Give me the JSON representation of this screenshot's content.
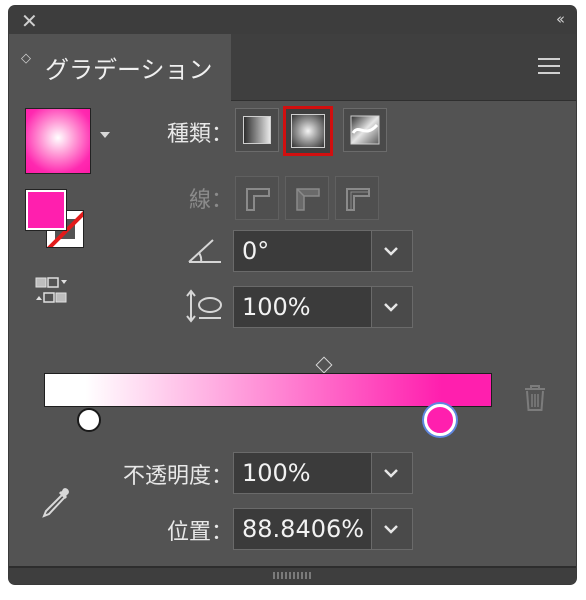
{
  "window": {
    "close_glyph": "✕",
    "collapse_glyph": "‹‹"
  },
  "tab": {
    "updown_glyph": "◇",
    "title": "グラデーション"
  },
  "type_row": {
    "label": "種類：",
    "options": [
      "linear-gradient",
      "radial-gradient",
      "freeform-gradient"
    ],
    "selected": "radial-gradient"
  },
  "stroke_row": {
    "label": "線："
  },
  "angle": {
    "value": "0°"
  },
  "aspect": {
    "value": "100%"
  },
  "ramp": {
    "start_color": "#ffffff",
    "end_color": "#ff1fae",
    "selected_stop_location": 88.84
  },
  "opacity": {
    "label": "不透明度：",
    "value": "100%"
  },
  "location": {
    "label": "位置：",
    "value": "88.8406%"
  },
  "colors": {
    "panel_bg": "#535353",
    "accent_pink": "#ff1fae",
    "selected_outline": "#d10f0f",
    "stop_ring": "#5f86e0"
  }
}
